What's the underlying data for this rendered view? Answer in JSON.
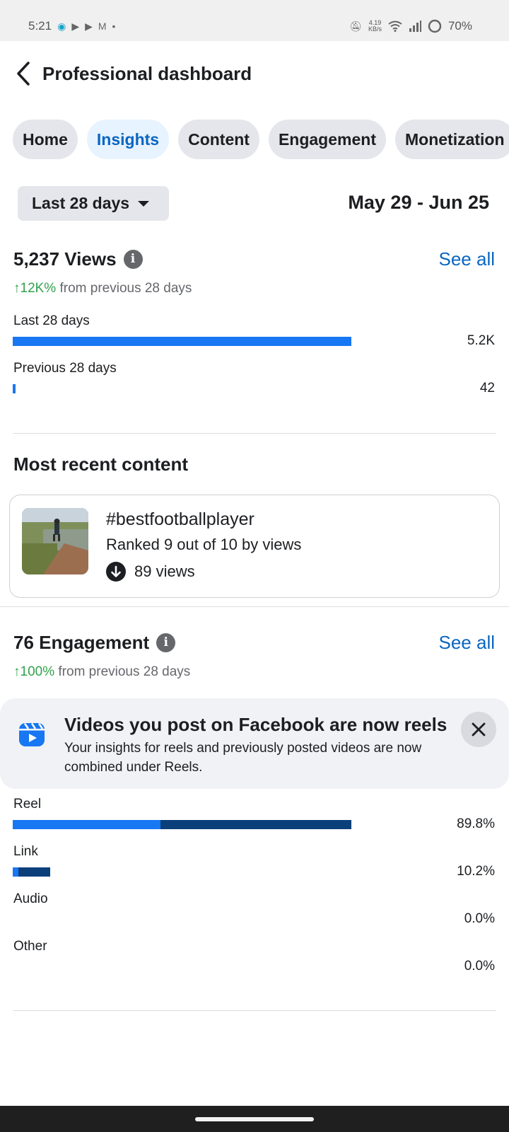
{
  "status_bar": {
    "time": "5:21",
    "network_speed_value": "4.19",
    "network_speed_unit": "KB/s",
    "battery": "70%"
  },
  "header": {
    "title": "Professional dashboard"
  },
  "tabs": [
    {
      "label": "Home",
      "active": false
    },
    {
      "label": "Insights",
      "active": true
    },
    {
      "label": "Content",
      "active": false
    },
    {
      "label": "Engagement",
      "active": false
    },
    {
      "label": "Monetization",
      "active": false
    }
  ],
  "date_filter": {
    "selected": "Last 28 days",
    "range": "May 29 - Jun 25"
  },
  "views": {
    "title": "5,237 Views",
    "see_all": "See all",
    "change_value": "↑12K%",
    "change_text": "from previous 28 days",
    "rows": [
      {
        "label": "Last 28 days",
        "value": "5.2K",
        "fraction": 0.7
      },
      {
        "label": "Previous 28 days",
        "value": "42",
        "fraction": 0.006
      }
    ]
  },
  "recent_content": {
    "heading": "Most recent content",
    "title": "#bestfootballplayer",
    "rank": "Ranked 9 out of 10 by views",
    "views": "89 views"
  },
  "engagement": {
    "title": "76 Engagement",
    "see_all": "See all",
    "change_value": "↑100%",
    "change_text": "from previous 28 days",
    "rows": [
      {
        "label": "Reel",
        "value": "89.8%",
        "light_fraction": 0.305,
        "dark_fraction": 0.395
      },
      {
        "label": "Link",
        "value": "10.2%",
        "light_fraction": 0.012,
        "dark_fraction": 0.066
      },
      {
        "label": "Audio",
        "value": "0.0%",
        "light_fraction": 0,
        "dark_fraction": 0
      },
      {
        "label": "Other",
        "value": "0.0%",
        "light_fraction": 0,
        "dark_fraction": 0
      }
    ]
  },
  "notice": {
    "title": "Videos you post on Facebook are now reels",
    "body": "Your insights for reels and previously posted videos are now combined under Reels."
  },
  "colors": {
    "accent_blue": "#0a66c2",
    "bar_light": "#1877f2",
    "bar_dark": "#0b3f7a",
    "positive_green": "#31a24c"
  }
}
